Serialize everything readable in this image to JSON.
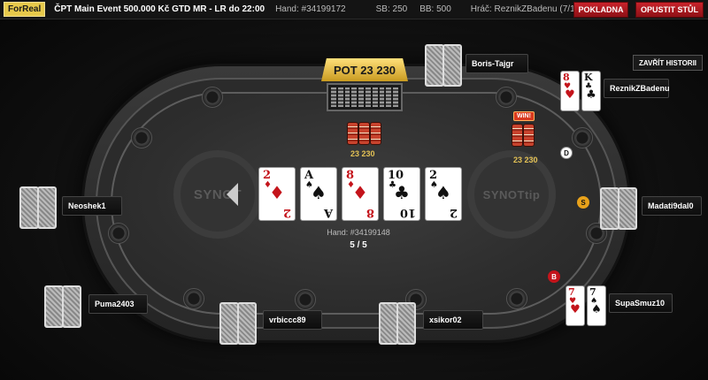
{
  "topbar": {
    "brand": "ForReal",
    "title": "ČPT Main Event 500.000 Kč GTD MR - LR do 22:00",
    "hand": "Hand: #34199172",
    "sb": "SB: 250",
    "bb": "BB: 500",
    "player": "Hráč: ReznikZBadenu (7/102)",
    "cashier_label": "POKLADNA",
    "leave_label": "OPUSTIT STŮL"
  },
  "history_button": "ZAVŘÍT HISTORII",
  "pot": {
    "label": "POT 23 230"
  },
  "chips": {
    "pot_amount": "23 230",
    "win_amount": "23 230",
    "win_badge": "WIN!"
  },
  "logos": {
    "left": "SYNOT",
    "right": "SYNOTtip"
  },
  "board": [
    {
      "rank": "2",
      "suit": "♦",
      "color": "red"
    },
    {
      "rank": "A",
      "suit": "♠",
      "color": "black"
    },
    {
      "rank": "8",
      "suit": "♦",
      "color": "red"
    },
    {
      "rank": "10",
      "suit": "♣",
      "color": "black"
    },
    {
      "rank": "2",
      "suit": "♠",
      "color": "black"
    }
  ],
  "hand_info": {
    "hand": "Hand: #34199148",
    "counter": "5 / 5"
  },
  "players": {
    "boris": "Boris-Tajgr",
    "reznik": "ReznikZBadenu",
    "madati": "Madati9dal0",
    "supasmuz": "SupaSmuz10",
    "xsikor": "xsikor02",
    "vrbiccc": "vrbiccc89",
    "puma": "Puma2403",
    "neoshek": "Neoshek1"
  },
  "hole_cards": {
    "reznik": [
      {
        "rank": "8",
        "suit": "♥",
        "color": "red"
      },
      {
        "rank": "K",
        "suit": "♣",
        "color": "black"
      }
    ],
    "supasmuz": [
      {
        "rank": "7",
        "suit": "♥",
        "color": "red"
      },
      {
        "rank": "7",
        "suit": "♠",
        "color": "black"
      }
    ]
  },
  "markers": {
    "dealer": "D",
    "small_blind": "S",
    "big_blind": "B"
  },
  "colors": {
    "accent_gold": "#e3c155",
    "button_red": "#c9232b",
    "felt": "#2e2e2e"
  }
}
